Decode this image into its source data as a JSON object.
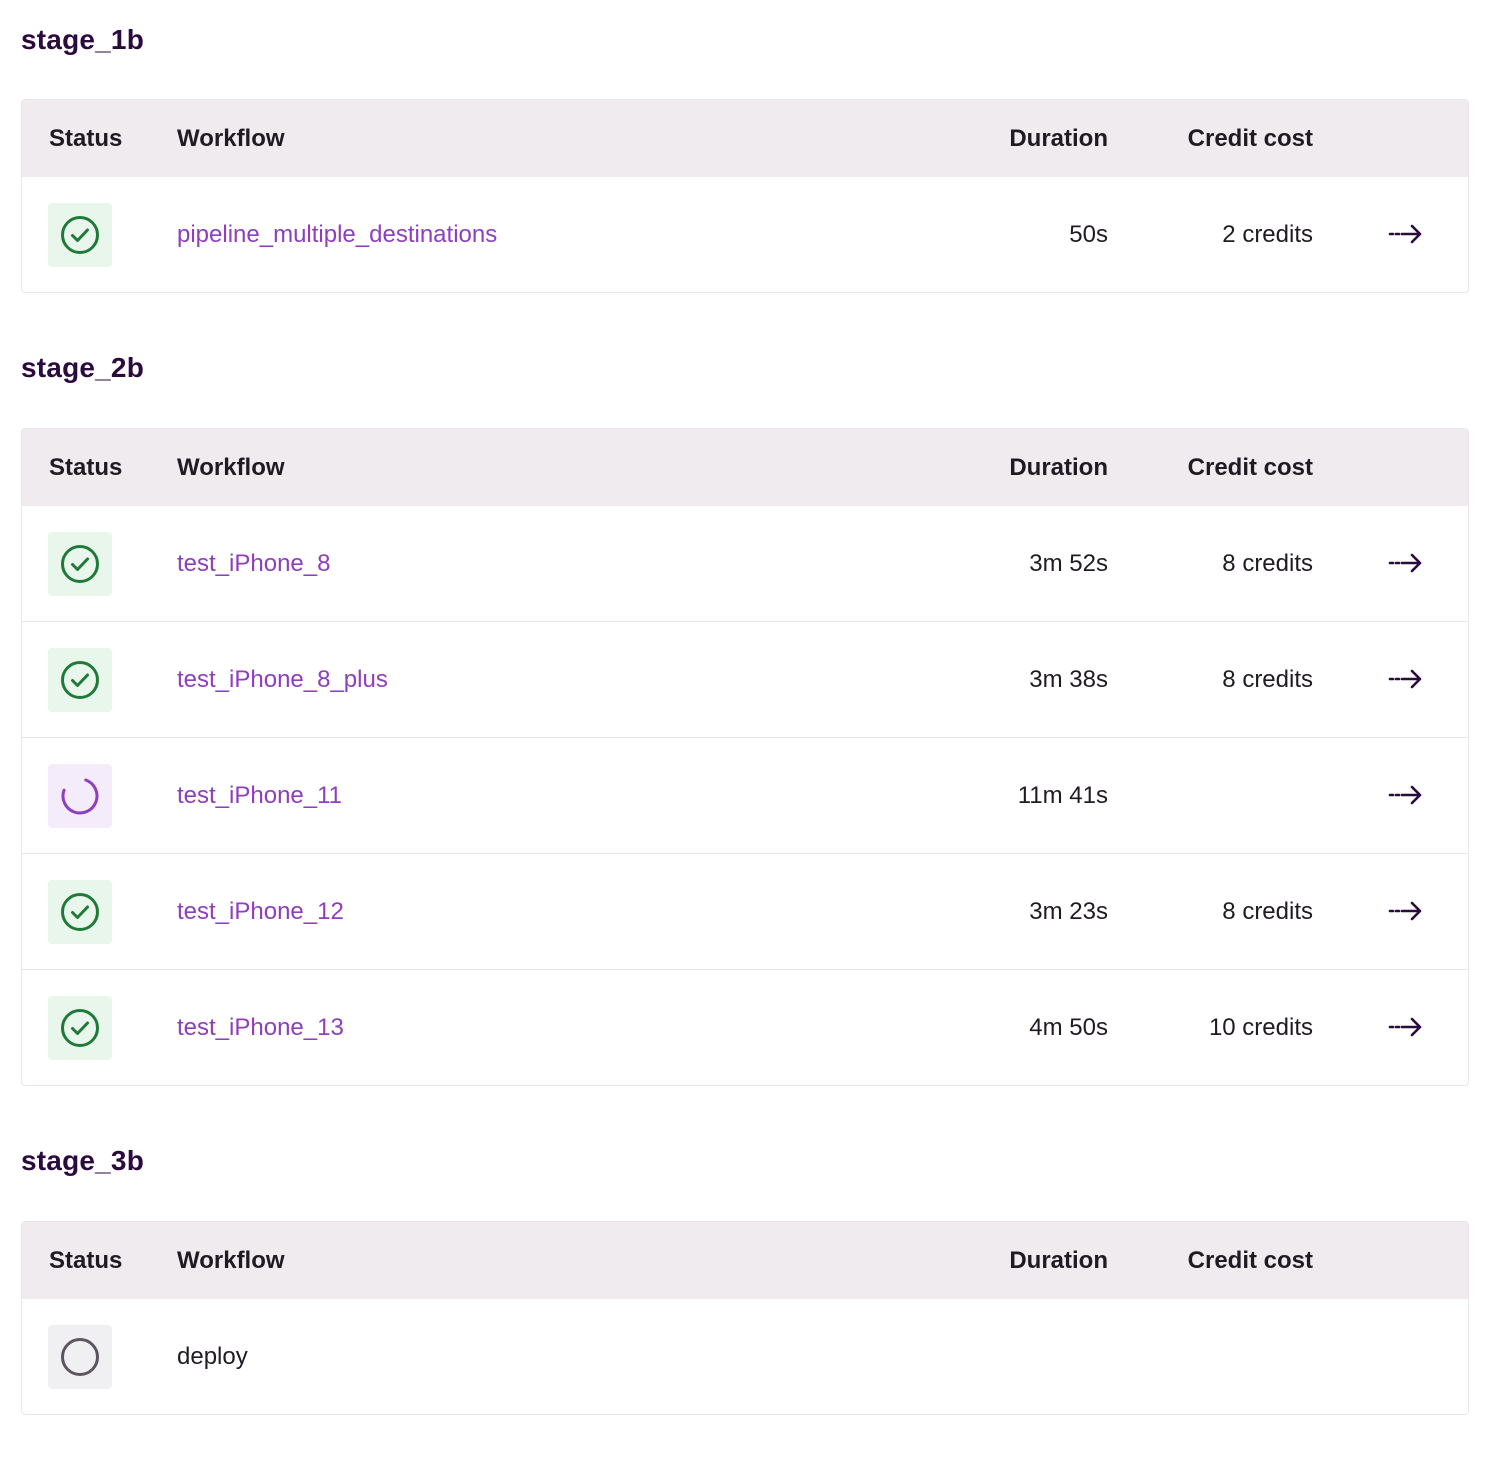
{
  "columns": {
    "status": "Status",
    "workflow": "Workflow",
    "duration": "Duration",
    "credit_cost": "Credit cost"
  },
  "colors": {
    "success": "#1f7a3a",
    "running": "#8e3fbd",
    "pending": "#5c5561",
    "link": "#8e3fbd",
    "heading": "#2b0a3d"
  },
  "stages": [
    {
      "title": "stage_1b",
      "rows": [
        {
          "status": "success",
          "status_icon": "check-circle-icon",
          "workflow": "pipeline_multiple_destinations",
          "duration": "50s",
          "credits": "2 credits",
          "has_link": true
        }
      ]
    },
    {
      "title": "stage_2b",
      "rows": [
        {
          "status": "success",
          "status_icon": "check-circle-icon",
          "workflow": "test_iPhone_8",
          "duration": "3m 52s",
          "credits": "8 credits",
          "has_link": true
        },
        {
          "status": "success",
          "status_icon": "check-circle-icon",
          "workflow": "test_iPhone_8_plus",
          "duration": "3m 38s",
          "credits": "8 credits",
          "has_link": true
        },
        {
          "status": "running",
          "status_icon": "spinner-icon",
          "workflow": "test_iPhone_11",
          "duration": "11m 41s",
          "credits": "",
          "has_link": true
        },
        {
          "status": "success",
          "status_icon": "check-circle-icon",
          "workflow": "test_iPhone_12",
          "duration": "3m 23s",
          "credits": "8 credits",
          "has_link": true
        },
        {
          "status": "success",
          "status_icon": "check-circle-icon",
          "workflow": "test_iPhone_13",
          "duration": "4m 50s",
          "credits": "10 credits",
          "has_link": true
        }
      ]
    },
    {
      "title": "stage_3b",
      "rows": [
        {
          "status": "pending",
          "status_icon": "empty-circle-icon",
          "workflow": "deploy",
          "duration": "",
          "credits": "",
          "has_link": false
        }
      ]
    }
  ]
}
